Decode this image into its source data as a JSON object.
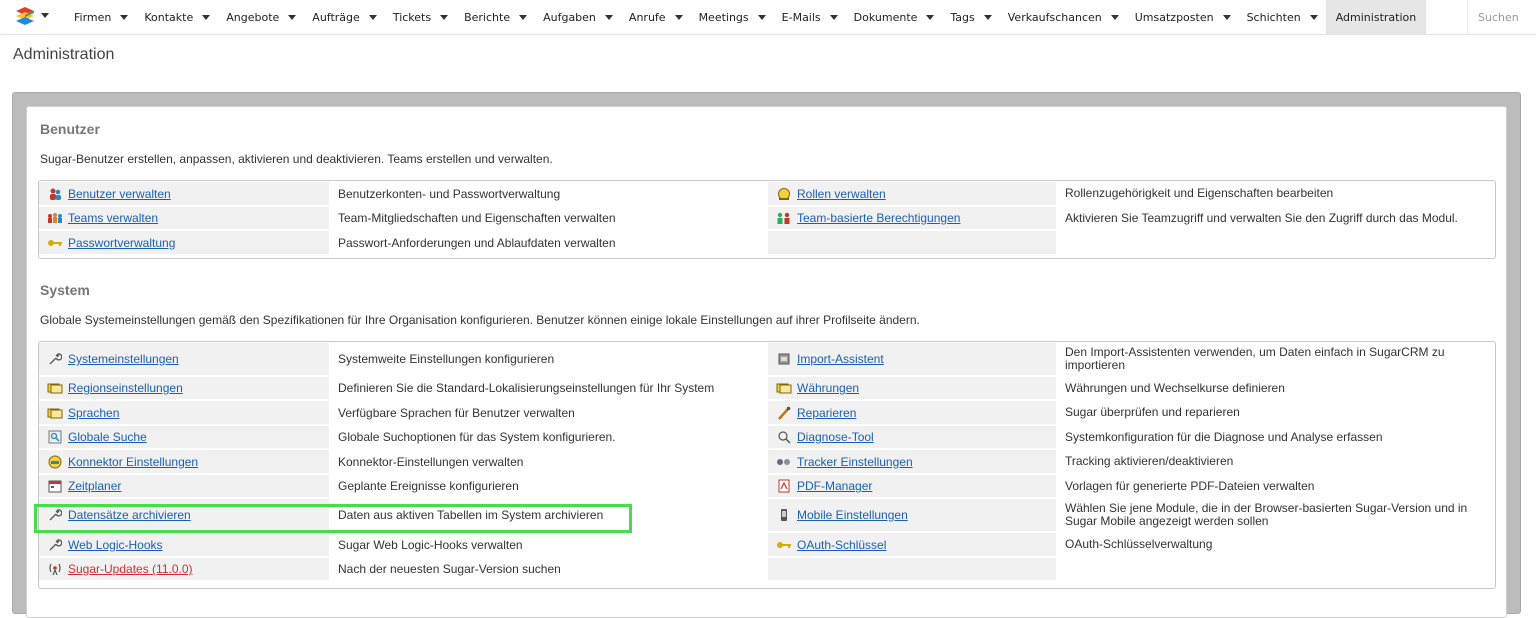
{
  "nav": {
    "items": [
      "Firmen",
      "Kontakte",
      "Angebote",
      "Aufträge",
      "Tickets",
      "Berichte",
      "Aufgaben",
      "Anrufe",
      "Meetings",
      "E-Mails",
      "Dokumente",
      "Tags",
      "Verkaufschancen",
      "Umsatzposten",
      "Schichten"
    ],
    "active": "Administration",
    "search_placeholder": "Suchen"
  },
  "page": {
    "title": "Administration"
  },
  "benutzer": {
    "title": "Benutzer",
    "description": "Sugar-Benutzer erstellen, anpassen, aktivieren und deaktivieren. Teams erstellen und verwalten.",
    "rows": [
      {
        "link1": "Benutzer verwalten",
        "icon1": "users-icon",
        "desc1": "Benutzerkonten- und Passwortverwaltung",
        "link2": "Rollen verwalten",
        "icon2": "roles-icon",
        "desc2": "Rollenzugehörigkeit und Eigenschaften bearbeiten"
      },
      {
        "link1": "Teams verwalten",
        "icon1": "teams-icon",
        "desc1": "Team-Mitgliedschaften und Eigenschaften verwalten",
        "link2": "Team-basierte Berechtigungen",
        "icon2": "team-permissions-icon",
        "desc2": "Aktivieren Sie Teamzugriff und verwalten Sie den Zugriff durch das Modul."
      },
      {
        "link1": "Passwortverwaltung",
        "icon1": "key-icon",
        "desc1": "Passwort-Anforderungen und Ablaufdaten verwalten",
        "link2": "",
        "icon2": "",
        "desc2": ""
      }
    ]
  },
  "system": {
    "title": "System",
    "description": "Globale Systemeinstellungen gemäß den Spezifikationen für Ihre Organisation konfigurieren. Benutzer können einige lokale Einstellungen auf ihrer Profilseite ändern.",
    "rows": [
      {
        "link1": "Systemeinstellungen",
        "icon1": "wrench-icon",
        "desc1": "Systemweite Einstellungen konfigurieren",
        "link2": "Import-Assistent",
        "icon2": "import-icon",
        "desc2": "Den Import-Assistenten verwenden, um Daten einfach in SugarCRM zu importieren"
      },
      {
        "link1": "Regionseinstellungen",
        "icon1": "currency-icon",
        "desc1": "Definieren Sie die Standard-Lokalisierungseinstellungen für Ihr System",
        "link2": "Währungen",
        "icon2": "currency-icon",
        "desc2": "Währungen und Wechselkurse definieren"
      },
      {
        "link1": "Sprachen",
        "icon1": "currency-icon",
        "desc1": "Verfügbare Sprachen für Benutzer verwalten",
        "link2": "Reparieren",
        "icon2": "repair-icon",
        "desc2": "Sugar überprüfen und reparieren"
      },
      {
        "link1": "Globale Suche",
        "icon1": "search-icon",
        "desc1": "Globale Suchoptionen für das System konfigurieren.",
        "link2": "Diagnose-Tool",
        "icon2": "diagnose-icon",
        "desc2": "Systemkonfiguration für die Diagnose und Analyse erfassen"
      },
      {
        "link1": "Konnektor Einstellungen",
        "icon1": "connector-icon",
        "desc1": "Konnektor-Einstellungen verwalten",
        "link2": "Tracker Einstellungen",
        "icon2": "tracker-icon",
        "desc2": "Tracking aktivieren/deaktivieren"
      },
      {
        "link1": "Zeitplaner",
        "icon1": "scheduler-icon",
        "desc1": "Geplante Ereignisse konfigurieren",
        "link2": "PDF-Manager",
        "icon2": "pdf-icon",
        "desc2": "Vorlagen für generierte PDF-Dateien verwalten"
      },
      {
        "link1": "Datensätze archivieren",
        "icon1": "wrench-icon",
        "desc1": "Daten aus aktiven Tabellen im System archivieren",
        "link2": "Mobile Einstellungen",
        "icon2": "mobile-icon",
        "desc2": "Wählen Sie jene Module, die in der Browser-basierten Sugar-Version und in Sugar Mobile angezeigt werden sollen"
      },
      {
        "link1": "Web Logic-Hooks",
        "icon1": "wrench-icon",
        "desc1": "Sugar Web Logic-Hooks verwalten",
        "link2": "OAuth-Schlüssel",
        "icon2": "key-icon",
        "desc2": "OAuth-Schlüsselverwaltung"
      },
      {
        "link1": "Sugar-Updates (11.0.0)",
        "icon1": "updates-icon",
        "desc1": "Nach der neuesten Sugar-Version suchen",
        "link2": "",
        "icon2": "",
        "desc2": ""
      }
    ]
  },
  "colors": {
    "link": "#1a5fb4",
    "update_link": "#d32f2f",
    "highlight": "#43e04a"
  }
}
